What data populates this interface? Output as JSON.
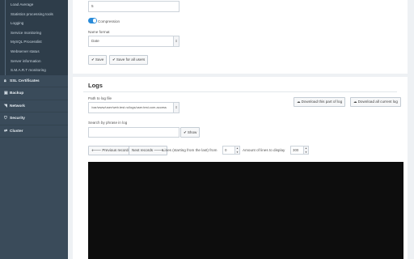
{
  "sidebar": {
    "subitems": [
      "Load Average",
      "Statistics processing tools",
      "Logging",
      "Service monitoring",
      "MySQL Processlist",
      "Webserver status",
      "Server information",
      "S.M.A.R.T monitoring"
    ],
    "main": [
      {
        "label": "SSL Certificates",
        "icon": "lock-icon",
        "glyph": "🔒︎"
      },
      {
        "label": "Backup",
        "icon": "database-icon",
        "glyph": "▣"
      },
      {
        "label": "Network",
        "icon": "rss-icon",
        "glyph": "◥"
      },
      {
        "label": "Security",
        "icon": "shield-icon",
        "glyph": "⛉"
      },
      {
        "label": "Cluster",
        "icon": "exchange-icon",
        "glyph": "⇄"
      }
    ]
  },
  "settings": {
    "number_value": "5",
    "compression_label": "Compression",
    "compression_on": true,
    "name_format_label": "Name format",
    "name_format_value": "Date",
    "save_label": "Save",
    "save_all_label": "Save for all users"
  },
  "logs": {
    "title": "Logs",
    "path_label": "Path to log file",
    "path_value": "/var/www/user/web.test.ru/logs/user.test.com.access",
    "download_part_label": "Download this part of log",
    "download_all_label": "Download all current log",
    "search_label": "Search by phrase in log",
    "search_value": "",
    "show_label": "Show",
    "prev_label": "Previous records",
    "next_label": "Next records",
    "lines_from_label": "Lines (starting from the last) from",
    "lines_from_value": "0",
    "amount_label": "Amount of lines to display",
    "amount_value": "300"
  },
  "colors": {
    "sidebar_bg": "#3a4b5a",
    "accent": "#2a8bd9",
    "log_bg": "#0d0d0d"
  }
}
